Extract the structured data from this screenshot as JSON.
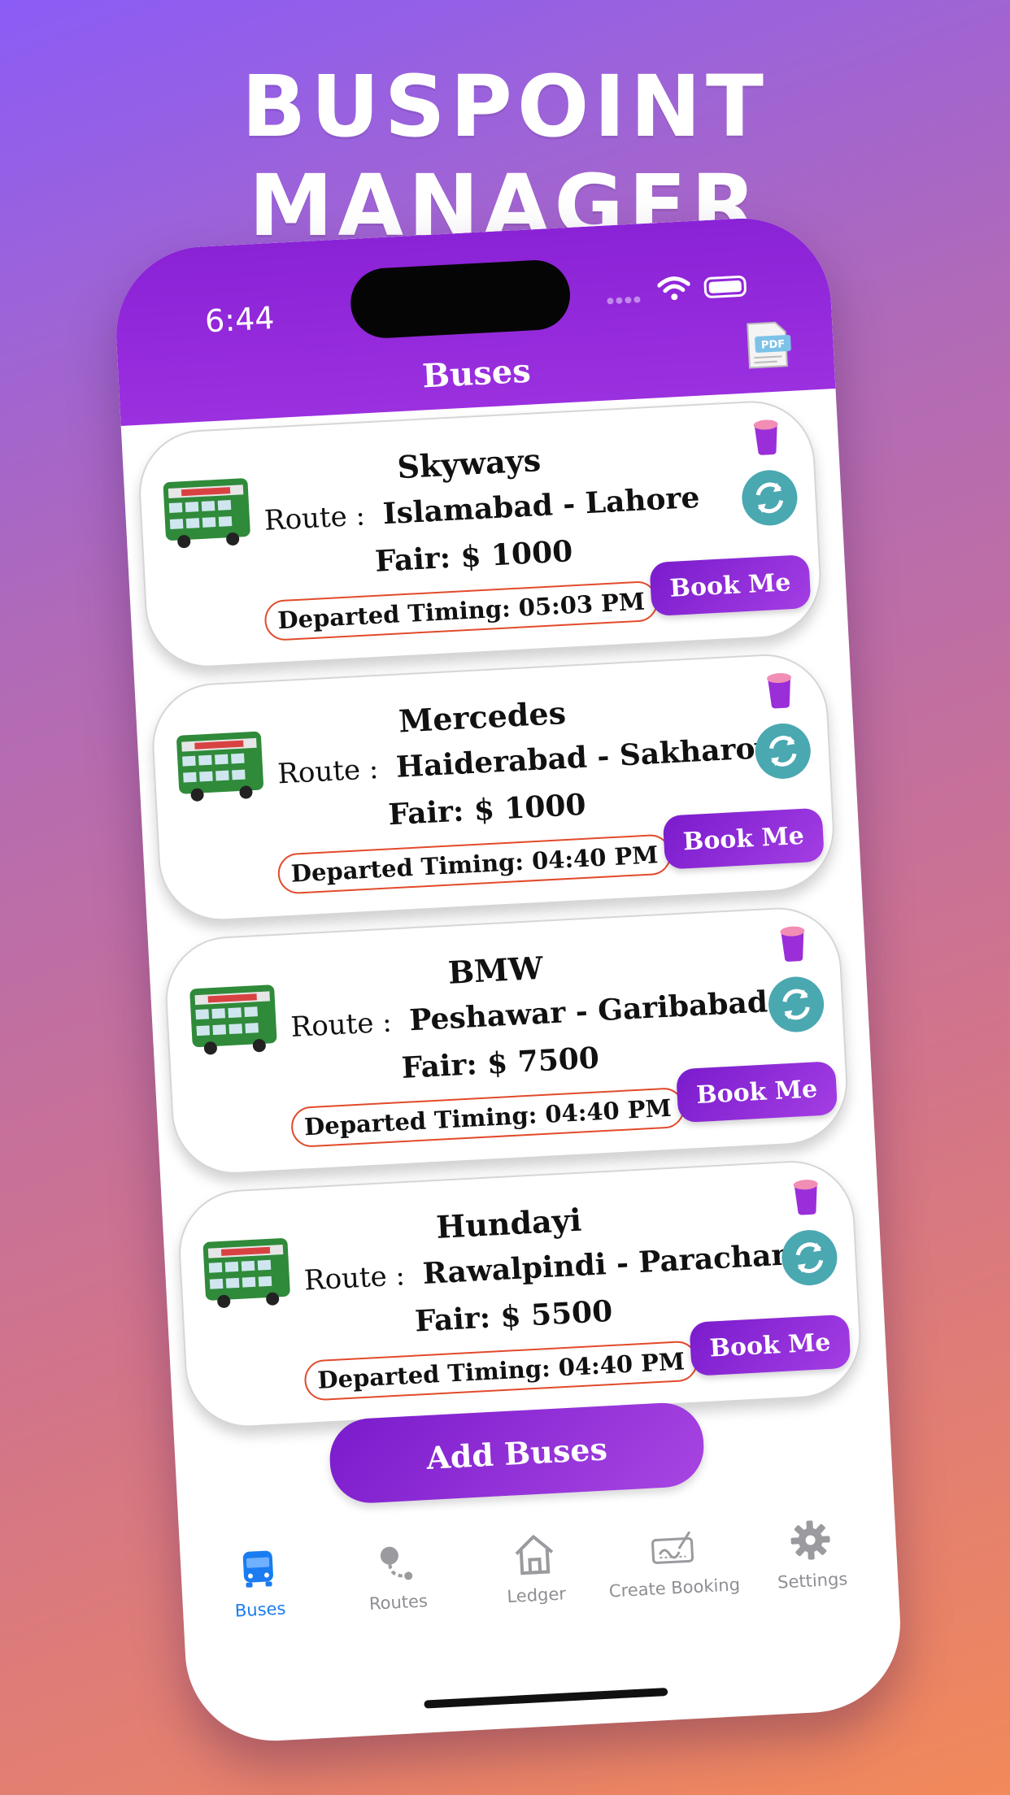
{
  "headline": "BUSPOINT MANAGER",
  "status_bar": {
    "time": "6:44"
  },
  "header": {
    "title": "Buses",
    "pdf_label": "PDF"
  },
  "buses": [
    {
      "name": "Skyways",
      "route_label": "Route :",
      "route": "Islamabad -  Lahore",
      "fare": "Fair: $ 1000",
      "departure": "Departed Timing: 05:03 PM",
      "book_label": "Book Me"
    },
    {
      "name": "Mercedes",
      "route_label": "Route :",
      "route": "Haiderabad -  Sakharov",
      "fare": "Fair: $ 1000",
      "departure": "Departed Timing: 04:40 PM",
      "book_label": "Book Me"
    },
    {
      "name": "BMW",
      "route_label": "Route :",
      "route": "Peshawar -  Garibabad",
      "fare": "Fair: $ 7500",
      "departure": "Departed Timing: 04:40 PM",
      "book_label": "Book Me"
    },
    {
      "name": "Hundayi",
      "route_label": "Route :",
      "route": "Rawalpindi -  Parachana",
      "fare": "Fair: $ 5500",
      "departure": "Departed Timing: 04:40 PM",
      "book_label": "Book Me"
    }
  ],
  "add_button_label": "Add Buses",
  "tabs": [
    {
      "label": "Buses",
      "icon": "bus-icon",
      "active": true
    },
    {
      "label": "Routes",
      "icon": "routes-icon",
      "active": false
    },
    {
      "label": "Ledger",
      "icon": "home-icon",
      "active": false
    },
    {
      "label": "Create Booking",
      "icon": "signature-icon",
      "active": false
    },
    {
      "label": "Settings",
      "icon": "gear-icon",
      "active": false
    }
  ],
  "colors": {
    "accent": "#8a22d6",
    "refresh": "#4aa8b1",
    "departure_border": "#e24a2b",
    "active_tab": "#1a7cf0"
  }
}
